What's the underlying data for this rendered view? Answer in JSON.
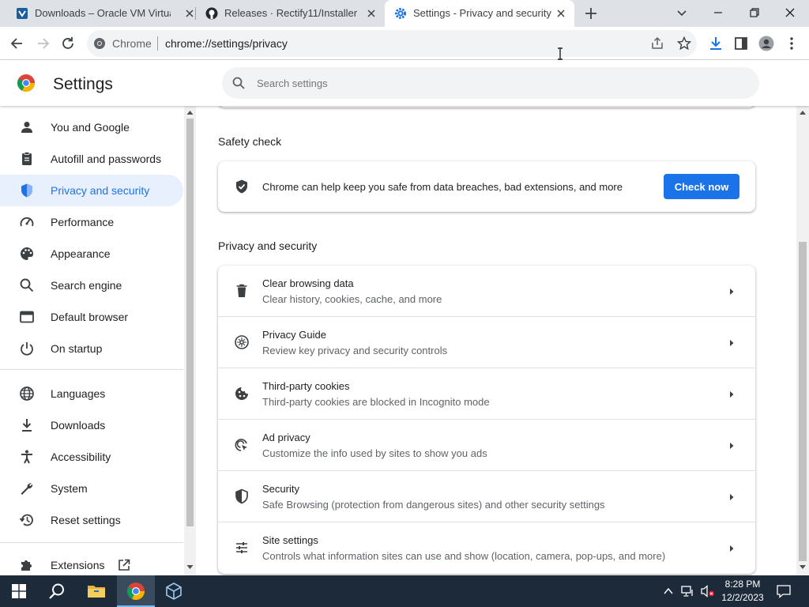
{
  "tabs": [
    {
      "title": "Downloads – Oracle VM VirtualBox",
      "icon": "virtualbox-icon"
    },
    {
      "title": "Releases · Rectify11/Installer",
      "icon": "github-icon"
    },
    {
      "title": "Settings - Privacy and security",
      "icon": "settings-gear-icon",
      "active": true
    }
  ],
  "omnibox": {
    "chip": "Chrome",
    "url": "chrome://settings/privacy"
  },
  "header": {
    "title": "Settings",
    "search_placeholder": "Search settings"
  },
  "sidebar": {
    "items": [
      {
        "label": "You and Google",
        "icon": "person-icon"
      },
      {
        "label": "Autofill and passwords",
        "icon": "clipboard-icon"
      },
      {
        "label": "Privacy and security",
        "icon": "shield-icon",
        "selected": true
      },
      {
        "label": "Performance",
        "icon": "speedometer-icon"
      },
      {
        "label": "Appearance",
        "icon": "palette-icon"
      },
      {
        "label": "Search engine",
        "icon": "search-icon"
      },
      {
        "label": "Default browser",
        "icon": "browser-window-icon"
      },
      {
        "label": "On startup",
        "icon": "power-icon"
      },
      {
        "label": "Languages",
        "icon": "globe-icon"
      },
      {
        "label": "Downloads",
        "icon": "download-icon"
      },
      {
        "label": "Accessibility",
        "icon": "accessibility-icon"
      },
      {
        "label": "System",
        "icon": "wrench-icon"
      },
      {
        "label": "Reset settings",
        "icon": "history-reset-icon"
      },
      {
        "label": "Extensions",
        "icon": "puzzle-icon"
      }
    ]
  },
  "safety_check": {
    "section_title": "Safety check",
    "text": "Chrome can help keep you safe from data breaches, bad extensions, and more",
    "button": "Check now"
  },
  "privacy": {
    "section_title": "Privacy and security",
    "rows": [
      {
        "title": "Clear browsing data",
        "subtitle": "Clear history, cookies, cache, and more",
        "icon": "trash-icon"
      },
      {
        "title": "Privacy Guide",
        "subtitle": "Review key privacy and security controls",
        "icon": "compass-icon"
      },
      {
        "title": "Third-party cookies",
        "subtitle": "Third-party cookies are blocked in Incognito mode",
        "icon": "cookie-icon"
      },
      {
        "title": "Ad privacy",
        "subtitle": "Customize the info used by sites to show you ads",
        "icon": "ad-target-icon"
      },
      {
        "title": "Security",
        "subtitle": "Safe Browsing (protection from dangerous sites) and other security settings",
        "icon": "shield-icon"
      },
      {
        "title": "Site settings",
        "subtitle": "Controls what information sites can use and show (location, camera, pop-ups, and more)",
        "icon": "sliders-icon"
      }
    ]
  },
  "taskbar": {
    "time": "8:28 PM",
    "date": "12/2/2023"
  },
  "colors": {
    "accent": "#1a73e8",
    "selected_bg": "#e8f0fe",
    "taskbar": "#1c2a3a"
  }
}
